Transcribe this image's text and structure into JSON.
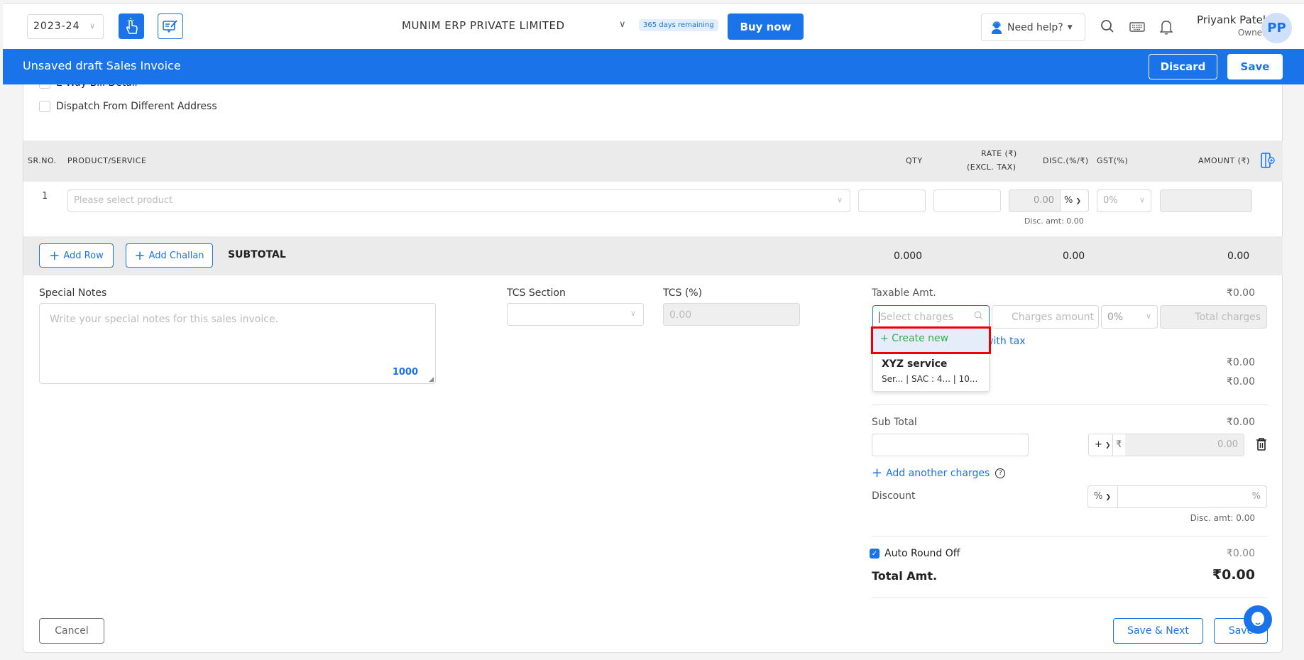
{
  "header": {
    "year": "2023-24",
    "company": "MUNIM ERP PRIVATE LIMITED",
    "trial_badge": "365 days remaining",
    "buy_now": "Buy now",
    "help": "Need help?",
    "user_name": "Priyank Patel",
    "user_role": "Owner",
    "avatar_initials": "PP",
    "icons": [
      "touch-icon",
      "notes-icon",
      "search-icon",
      "keyboard-icon",
      "bell-icon"
    ]
  },
  "titlebar": {
    "title": "Unsaved draft Sales Invoice",
    "discard": "Discard",
    "save": "Save"
  },
  "options": {
    "eway": "E-Way Bill Detail",
    "dispatch": "Dispatch From Different Address"
  },
  "table": {
    "headers": {
      "sr": "SR.NO.",
      "product": "PRODUCT/SERVICE",
      "qty": "QTY",
      "rate1": "RATE (₹)",
      "rate2": "(EXCL. TAX)",
      "disc": "DISC.(%/₹)",
      "gst": "GST(%)",
      "amount": "AMOUNT (₹)"
    },
    "rows": [
      {
        "sr": "1",
        "product_placeholder": "Please select product",
        "disc_value": "0.00",
        "disc_type": "%",
        "gst": "0%",
        "disc_amt": "Disc. amt: 0.00"
      }
    ],
    "add_row": "Add Row",
    "add_challan": "Add Challan",
    "subtotal_label": "SUBTOTAL",
    "subtotal_qty": "0.000",
    "subtotal_disc": "0.00",
    "subtotal_amount": "0.00"
  },
  "notes": {
    "label": "Special Notes",
    "placeholder": "Write your special notes for this sales invoice.",
    "counter": "1000"
  },
  "tcs": {
    "section_label": "TCS Section",
    "percent_label": "TCS (%)",
    "percent_value": "0.00"
  },
  "summary": {
    "taxable_label": "Taxable Amt.",
    "taxable_value": "₹0.00",
    "charges_placeholder": "Select charges",
    "charges_amount_placeholder": "Charges amount",
    "charges_gst": "0%",
    "total_charges_placeholder": "Total charges",
    "with_tax_link": "with tax",
    "row1_value": "₹0.00",
    "row2_value": "₹0.00",
    "subtotal_label": "Sub Total",
    "subtotal_value": "₹0.00",
    "adj_sign": "+",
    "adj_currency": "₹",
    "adj_value": "0.00",
    "add_another": "Add another charges",
    "discount_label": "Discount",
    "discount_type": "%",
    "discount_suffix": "%",
    "disc_amt": "Disc. amt: 0.00",
    "round_off_label": "Auto Round Off",
    "round_off_checked": true,
    "round_off_value": "₹0.00",
    "total_label": "Total Amt.",
    "total_value": "₹0.00"
  },
  "dropdown": {
    "create_new": "+ Create new",
    "item_name": "XYZ service",
    "item_meta": "Ser... | SAC : 4... | 10..."
  },
  "footer": {
    "cancel": "Cancel",
    "save_next": "Save & Next",
    "save": "Save"
  }
}
